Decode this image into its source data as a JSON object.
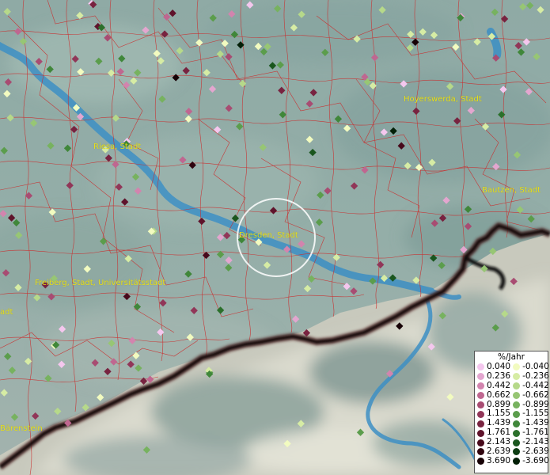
{
  "legend": {
    "title": "%/Jahr",
    "positive": [
      {
        "label": "0.040",
        "color": "#f4c7ee"
      },
      {
        "label": "0.236",
        "color": "#e3a6cf"
      },
      {
        "label": "0.442",
        "color": "#d284ae"
      },
      {
        "label": "0.662",
        "color": "#bf6790"
      },
      {
        "label": "0.899",
        "color": "#a84c72"
      },
      {
        "label": "1.155",
        "color": "#913658"
      },
      {
        "label": "1.439",
        "color": "#782340"
      },
      {
        "label": "1.761",
        "color": "#5f132b"
      },
      {
        "label": "2.143",
        "color": "#47091b"
      },
      {
        "label": "2.639",
        "color": "#2f040f"
      },
      {
        "label": "3.690",
        "color": "#170106"
      }
    ],
    "negative": [
      {
        "label": "-0.040",
        "color": "#f2fbc0"
      },
      {
        "label": "-0.236",
        "color": "#d6eca4"
      },
      {
        "label": "-0.442",
        "color": "#b6d98a"
      },
      {
        "label": "-0.662",
        "color": "#97c674"
      },
      {
        "label": "-0.899",
        "color": "#77b25f"
      },
      {
        "label": "-1.155",
        "color": "#5b9d4c"
      },
      {
        "label": "-1.439",
        "color": "#40873a"
      },
      {
        "label": "-1.761",
        "color": "#2b702b"
      },
      {
        "label": "-2.143",
        "color": "#1a561e"
      },
      {
        "label": "-2.639",
        "color": "#0c3c12"
      },
      {
        "label": "-3.690",
        "color": "#031f07"
      }
    ]
  },
  "cities": [
    {
      "name": "Hoyerswerda, Stadt"
    },
    {
      "name": "Riesa, Stadt"
    },
    {
      "name": "Bautzen, Stadt"
    },
    {
      "name": "Dresden, Stadt"
    },
    {
      "name": "Freiberg, Stadt, Universitätsstadt"
    },
    {
      "name": "adt"
    },
    {
      "name": "Bärenstein"
    }
  ],
  "colors": {
    "border_lines": "#cc2a2a",
    "river": "#3d8fc4",
    "state_border": "#111111",
    "label": "#e8e11a",
    "highlight_ring": "#ffffff"
  }
}
